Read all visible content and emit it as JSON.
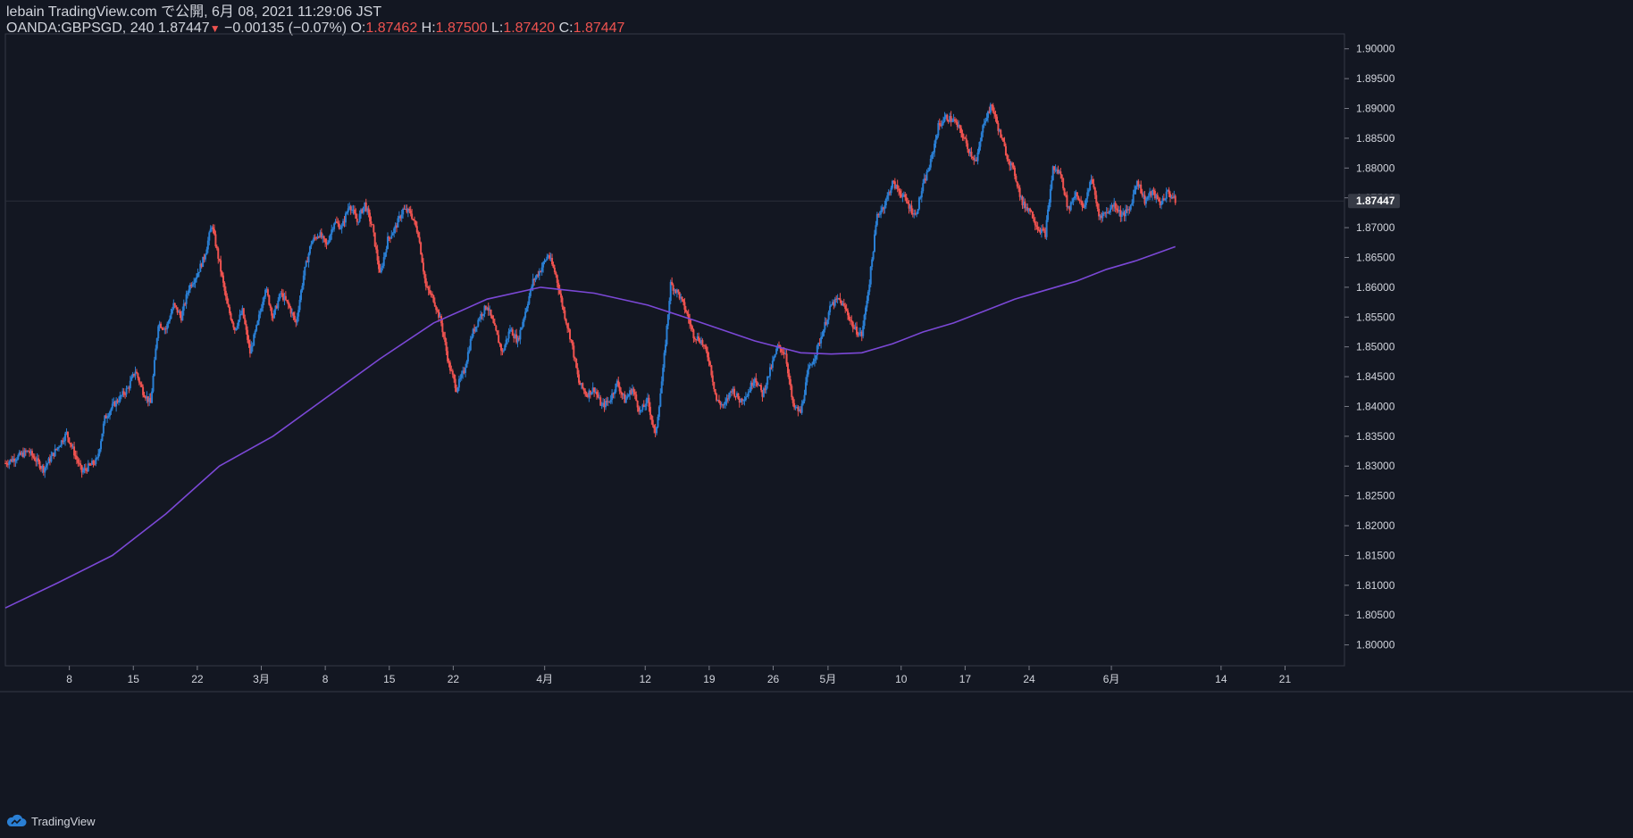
{
  "header": {
    "published": "lebain TradingView.com で公開, 6月 08, 2021 11:29:06 JST",
    "symbol": "OANDA:GBPSGD, 240",
    "last": "1.87447",
    "change": "−0.00135 (−0.07%)",
    "o_label": "O:",
    "o_value": "1.87462",
    "h_label": "H:",
    "h_value": "1.87500",
    "l_label": "L:",
    "l_value": "1.87420",
    "c_label": "C:",
    "c_value": "1.87447"
  },
  "footer": {
    "brand": "TradingView"
  },
  "colors": {
    "background": "#131722",
    "up": "#2a7fd4",
    "down": "#ef5350",
    "ma": "#7b48d6",
    "grid_text": "#d1d4dc",
    "last_badge": "#363a45"
  },
  "chart_data": {
    "type": "candlestick",
    "y_ticks": [
      "1.90000",
      "1.89500",
      "1.89000",
      "1.88500",
      "1.88000",
      "1.87500",
      "1.87000",
      "1.86500",
      "1.86000",
      "1.85500",
      "1.85000",
      "1.84500",
      "1.84000",
      "1.83500",
      "1.83000",
      "1.82500",
      "1.82000",
      "1.81500",
      "1.81000",
      "1.80500",
      "1.80000"
    ],
    "ylim": [
      1.7965,
      1.9025
    ],
    "last_value_label": "1.87447",
    "last_value": 1.87447,
    "x_tick_labels": [
      "8",
      "15",
      "22",
      "3月",
      "8",
      "15",
      "22",
      "4月",
      "12",
      "19",
      "26",
      "5月",
      "10",
      "17",
      "24",
      "6月",
      "14",
      "21"
    ],
    "x_ticks_day_index": [
      7,
      14,
      21,
      28,
      35,
      42,
      49,
      59,
      70,
      77,
      84,
      90,
      98,
      105,
      112,
      121,
      133,
      140
    ],
    "x_range_days": [
      0,
      146.5
    ],
    "last_bar_day": 128,
    "price_path": [
      [
        0,
        1.8305
      ],
      [
        3,
        1.8325
      ],
      [
        5,
        1.8295
      ],
      [
        8,
        1.8355
      ],
      [
        10,
        1.829
      ],
      [
        12,
        1.831
      ],
      [
        13,
        1.838
      ],
      [
        14,
        1.84
      ],
      [
        16,
        1.843
      ],
      [
        17,
        1.846
      ],
      [
        18,
        1.8425
      ],
      [
        19,
        1.8405
      ],
      [
        20,
        1.854
      ],
      [
        21,
        1.853
      ],
      [
        22,
        1.857
      ],
      [
        23,
        1.855
      ],
      [
        24,
        1.86
      ],
      [
        25,
        1.862
      ],
      [
        26,
        1.865
      ],
      [
        27,
        1.8705
      ],
      [
        28,
        1.864
      ],
      [
        29,
        1.857
      ],
      [
        30,
        1.853
      ],
      [
        31,
        1.856
      ],
      [
        32,
        1.849
      ],
      [
        33,
        1.854
      ],
      [
        34,
        1.86
      ],
      [
        35,
        1.855
      ],
      [
        36,
        1.859
      ],
      [
        37,
        1.857
      ],
      [
        38,
        1.854
      ],
      [
        39,
        1.862
      ],
      [
        40,
        1.8675
      ],
      [
        41,
        1.869
      ],
      [
        42,
        1.867
      ],
      [
        43,
        1.871
      ],
      [
        44,
        1.87
      ],
      [
        45,
        1.874
      ],
      [
        46,
        1.871
      ],
      [
        47,
        1.874
      ],
      [
        48,
        1.87
      ],
      [
        49,
        1.862
      ],
      [
        50,
        1.868
      ],
      [
        51,
        1.87
      ],
      [
        52,
        1.873
      ],
      [
        53,
        1.8725
      ],
      [
        54,
        1.869
      ],
      [
        55,
        1.86
      ],
      [
        56,
        1.858
      ],
      [
        57,
        1.854
      ],
      [
        58,
        1.847
      ],
      [
        59,
        1.843
      ],
      [
        60,
        1.846
      ],
      [
        61,
        1.852
      ],
      [
        62,
        1.855
      ],
      [
        63,
        1.857
      ],
      [
        64,
        1.853
      ],
      [
        65,
        1.849
      ],
      [
        66,
        1.853
      ],
      [
        67,
        1.851
      ],
      [
        68,
        1.856
      ],
      [
        69,
        1.861
      ],
      [
        70,
        1.863
      ],
      [
        71,
        1.8655
      ],
      [
        72,
        1.862
      ],
      [
        73,
        1.856
      ],
      [
        74,
        1.851
      ],
      [
        75,
        1.844
      ],
      [
        76,
        1.842
      ],
      [
        77,
        1.843
      ],
      [
        78,
        1.84
      ],
      [
        79,
        1.841
      ],
      [
        80,
        1.844
      ],
      [
        81,
        1.841
      ],
      [
        82,
        1.843
      ],
      [
        83,
        1.839
      ],
      [
        84,
        1.841
      ],
      [
        85,
        1.835
      ],
      [
        86,
        1.846
      ],
      [
        87,
        1.8605
      ],
      [
        88,
        1.859
      ],
      [
        89,
        1.856
      ],
      [
        90,
        1.852
      ],
      [
        91,
        1.851
      ],
      [
        92,
        1.848
      ],
      [
        93,
        1.841
      ],
      [
        94,
        1.84
      ],
      [
        95,
        1.843
      ],
      [
        96,
        1.841
      ],
      [
        97,
        1.842
      ],
      [
        98,
        1.845
      ],
      [
        99,
        1.842
      ],
      [
        100,
        1.846
      ],
      [
        101,
        1.85
      ],
      [
        102,
        1.849
      ],
      [
        103,
        1.84
      ],
      [
        104,
        1.839
      ],
      [
        105,
        1.846
      ],
      [
        106,
        1.849
      ],
      [
        107,
        1.853
      ],
      [
        108,
        1.857
      ],
      [
        109,
        1.858
      ],
      [
        110,
        1.856
      ],
      [
        111,
        1.853
      ],
      [
        112,
        1.852
      ],
      [
        113,
        1.861
      ],
      [
        114,
        1.872
      ],
      [
        115,
        1.874
      ],
      [
        116,
        1.8775
      ],
      [
        117,
        1.876
      ],
      [
        118,
        1.874
      ],
      [
        119,
        1.872
      ],
      [
        120,
        1.877
      ],
      [
        121,
        1.881
      ],
      [
        122,
        1.887
      ],
      [
        123,
        1.8885
      ],
      [
        124,
        1.888
      ],
      [
        125,
        1.886
      ],
      [
        126,
        1.883
      ],
      [
        127,
        1.881
      ],
      [
        128,
        1.888
      ],
      [
        129,
        1.8905
      ],
      [
        130,
        1.886
      ],
      [
        131,
        1.882
      ],
      [
        132,
        1.879
      ],
      [
        133,
        1.874
      ],
      [
        134,
        1.873
      ],
      [
        135,
        1.87
      ],
      [
        136,
        1.869
      ],
      [
        137,
        1.88
      ],
      [
        138,
        1.879
      ],
      [
        139,
        1.873
      ],
      [
        140,
        1.876
      ],
      [
        141,
        1.873
      ],
      [
        142,
        1.8785
      ],
      [
        143,
        1.872
      ],
      [
        144,
        1.8725
      ],
      [
        145,
        1.874
      ],
      [
        146,
        1.872
      ],
      [
        147,
        1.873
      ],
      [
        148,
        1.878
      ],
      [
        149,
        1.8745
      ],
      [
        150,
        1.876
      ],
      [
        151,
        1.874
      ],
      [
        152,
        1.876
      ],
      [
        153,
        1.8745
      ]
    ],
    "ma_path": [
      [
        0,
        1.8062
      ],
      [
        7,
        1.8105
      ],
      [
        14,
        1.815
      ],
      [
        21,
        1.822
      ],
      [
        28,
        1.83
      ],
      [
        35,
        1.835
      ],
      [
        42,
        1.8415
      ],
      [
        49,
        1.848
      ],
      [
        56,
        1.854
      ],
      [
        63,
        1.858
      ],
      [
        70,
        1.86
      ],
      [
        77,
        1.859
      ],
      [
        84,
        1.857
      ],
      [
        90,
        1.8545
      ],
      [
        98,
        1.851
      ],
      [
        104,
        1.849
      ],
      [
        108,
        1.8488
      ],
      [
        112,
        1.849
      ],
      [
        116,
        1.8505
      ],
      [
        120,
        1.8525
      ],
      [
        124,
        1.854
      ],
      [
        128,
        1.856
      ],
      [
        132,
        1.858
      ],
      [
        136,
        1.8595
      ],
      [
        140,
        1.861
      ],
      [
        144,
        1.863
      ],
      [
        148,
        1.8645
      ],
      [
        153,
        1.8668
      ]
    ]
  }
}
